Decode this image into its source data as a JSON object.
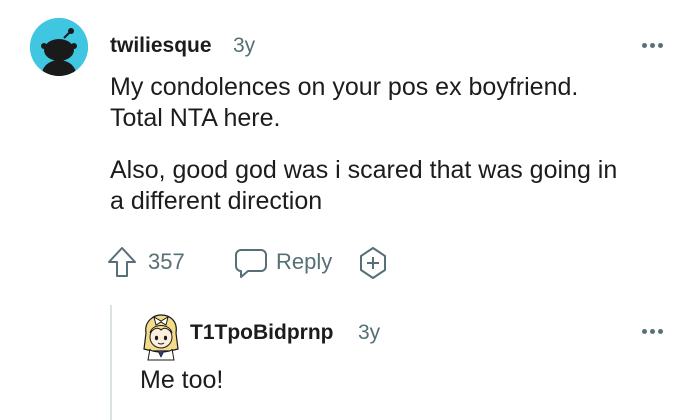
{
  "comment": {
    "username": "twiliesque",
    "age": "3y",
    "paragraph1_line1": "My condolences on your pos ex boyfriend.",
    "paragraph1_line2": "Total NTA here.",
    "paragraph2_line1": "Also, good god was i scared that was going in",
    "paragraph2_line2": "a different direction",
    "score": "357",
    "reply_label": "Reply",
    "avatar_color": "#3fc6e0"
  },
  "reply": {
    "username": "T1TpoBidprnp",
    "age": "3y",
    "text": "Me too!"
  },
  "icons": {
    "more": "more-dots-icon",
    "upvote": "upvote-arrow-icon",
    "reply": "speech-bubble-icon",
    "award": "award-plus-icon"
  },
  "colors": {
    "text": "#1c1c1c",
    "meta": "#576f76",
    "thread_line": "#dbe2e5"
  }
}
